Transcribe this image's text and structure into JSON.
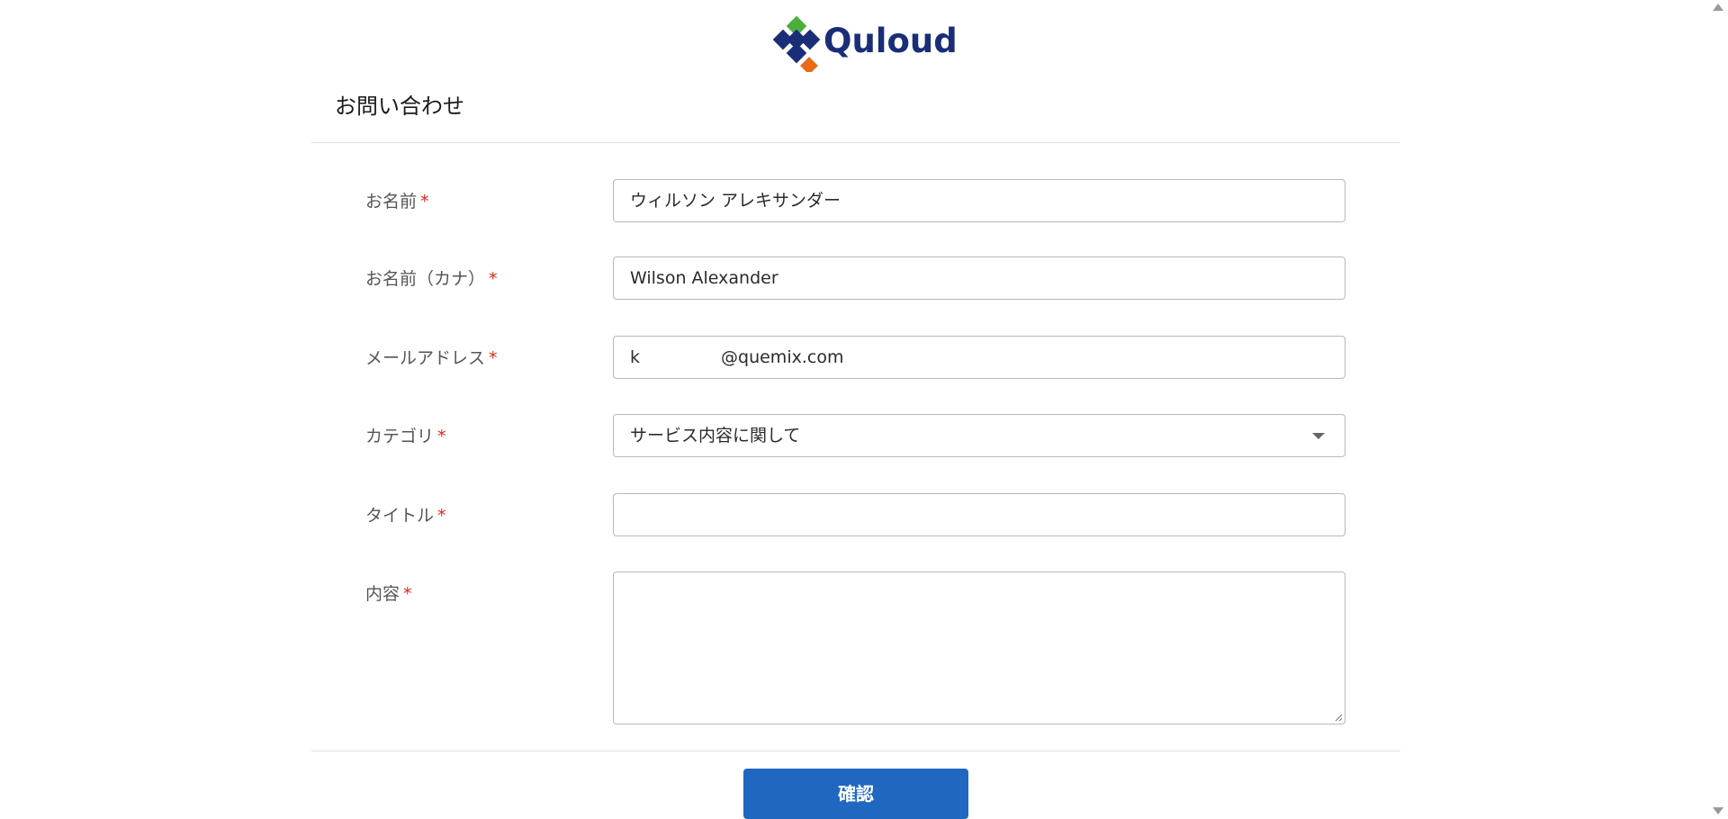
{
  "logo": {
    "text": "Quloud",
    "colors": {
      "green": "#4caf3c",
      "navy": "#1a2e78",
      "orange": "#ea6a17"
    }
  },
  "form": {
    "title": "お問い合わせ",
    "required_mark": "*",
    "fields": {
      "name": {
        "label": "お名前",
        "value": "ウィルソン アレキサンダー"
      },
      "name_kana": {
        "label": "お名前（カナ）",
        "value": "Wilson Alexander"
      },
      "email": {
        "label": "メールアドレス",
        "value_prefix": "k",
        "value_visible": "@quemix.com"
      },
      "category": {
        "label": "カテゴリ",
        "value": "サービス内容に関して"
      },
      "title": {
        "label": "タイトル",
        "value": ""
      },
      "content": {
        "label": "内容",
        "value": ""
      }
    },
    "submit_label": "確認"
  },
  "colors": {
    "accent": "#1f67c0",
    "required": "#e0261b",
    "border": "#b8b8b8"
  }
}
